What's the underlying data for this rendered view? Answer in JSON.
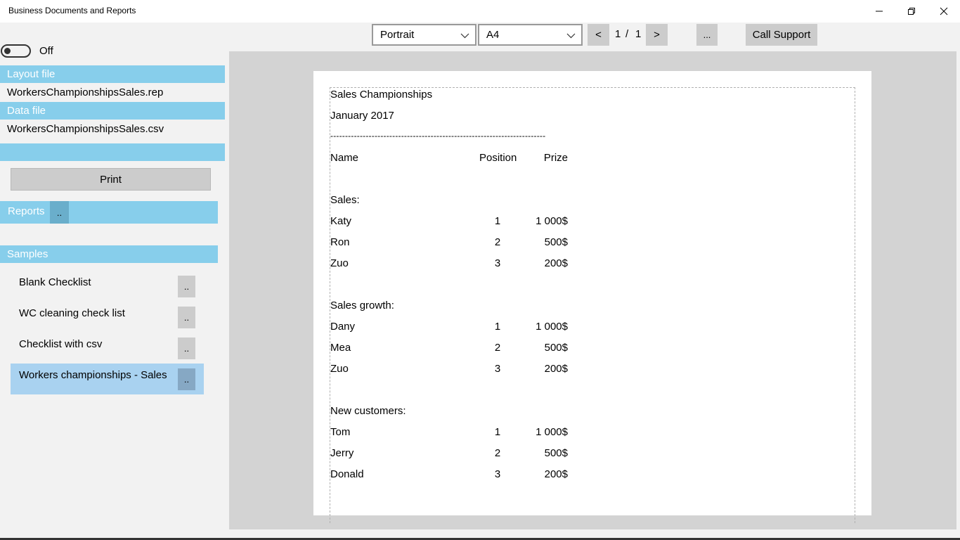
{
  "window": {
    "title": "Business Documents and Reports"
  },
  "toggle": {
    "label": "Off"
  },
  "layout_file": {
    "header": "Layout file",
    "value": "WorkersChampionshipsSales.rep"
  },
  "data_file": {
    "header": "Data file",
    "value": "WorkersChampionshipsSales.csv"
  },
  "print_label": "Print",
  "reports": {
    "label": "Reports",
    "more": ".."
  },
  "samples": {
    "header": "Samples",
    "items": [
      {
        "label": "Blank Checklist",
        "more": ".."
      },
      {
        "label": "WC cleaning check list",
        "more": ".."
      },
      {
        "label": "Checklist with csv",
        "more": ".."
      },
      {
        "label": "Workers championships - Sales",
        "more": ".."
      }
    ]
  },
  "toolbar": {
    "orientation": "Portrait",
    "paper": "A4",
    "prev": "<",
    "page_current": "1",
    "page_sep": "/",
    "page_total": "1",
    "next": ">",
    "more": "...",
    "support": "Call Support"
  },
  "report": {
    "title": "Sales Championships",
    "date": "January 2017",
    "divider": "-------------------------------------------------------------------------",
    "headers": {
      "name": "Name",
      "position": "Position",
      "prize": "Prize"
    },
    "sections": [
      {
        "title": "Sales:",
        "rows": [
          {
            "name": "Katy",
            "position": "1",
            "prize": "1 000$"
          },
          {
            "name": "Ron",
            "position": "2",
            "prize": "500$"
          },
          {
            "name": "Zuo",
            "position": "3",
            "prize": "200$"
          }
        ]
      },
      {
        "title": "Sales growth:",
        "rows": [
          {
            "name": "Dany",
            "position": "1",
            "prize": "1 000$"
          },
          {
            "name": "Mea",
            "position": "2",
            "prize": "500$"
          },
          {
            "name": "Zuo",
            "position": "3",
            "prize": "200$"
          }
        ]
      },
      {
        "title": "New customers:",
        "rows": [
          {
            "name": "Tom",
            "position": "1",
            "prize": "1 000$"
          },
          {
            "name": "Jerry",
            "position": "2",
            "prize": "500$"
          },
          {
            "name": "Donald",
            "position": "3",
            "prize": "200$"
          }
        ]
      }
    ]
  }
}
